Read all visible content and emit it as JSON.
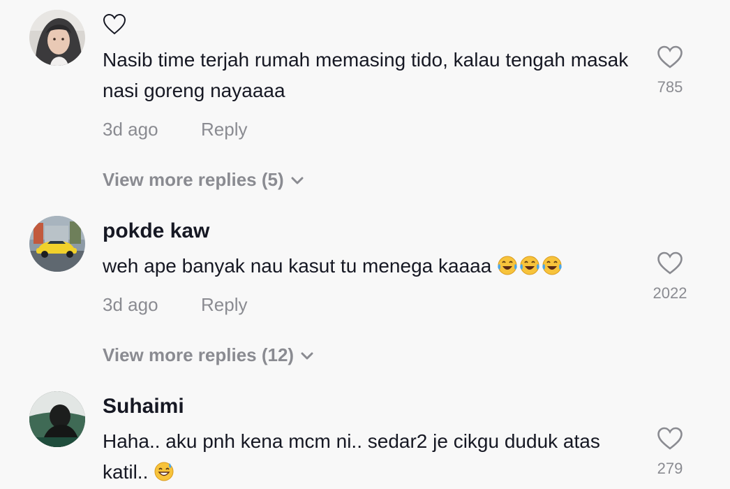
{
  "comments": [
    {
      "username": "",
      "text": "Nasib time terjah rumah memasing tido, kalau tengah masak nasi goreng nayaaaa",
      "emojis": [],
      "time": "3d ago",
      "reply_label": "Reply",
      "likes": "785",
      "view_more": "View more replies (5)"
    },
    {
      "username": "pokde kaw",
      "text": "weh ape banyak nau kasut tu menega kaaaa",
      "emojis": [
        "face-with-tears-of-joy",
        "face-with-tears-of-joy",
        "face-with-tears-of-joy"
      ],
      "time": "3d ago",
      "reply_label": "Reply",
      "likes": "2022",
      "view_more": "View more replies (12)"
    },
    {
      "username": "Suhaimi",
      "text": "Haha.. aku pnh kena mcm ni.. sedar2 je cikgu duduk atas katil..",
      "emojis": [
        "grinning-face-with-sweat"
      ],
      "likes": "279"
    }
  ],
  "colors": {
    "background": "#f8f8f8",
    "primary_text": "#161823",
    "secondary_text": "#8a8b91"
  },
  "icons": {
    "username_placeholder": "heart-outline-icon",
    "like": "heart-outline-icon",
    "expand": "chevron-down-icon"
  }
}
